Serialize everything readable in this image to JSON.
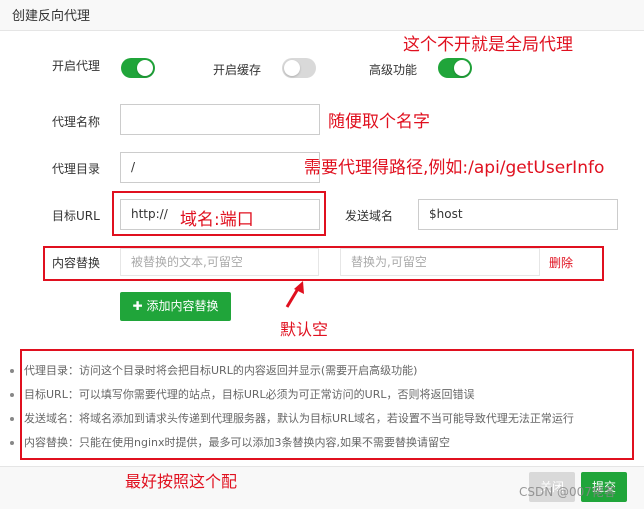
{
  "dialog": {
    "title": "创建反向代理"
  },
  "form": {
    "enable_proxy_label": "开启代理",
    "enable_proxy_on": true,
    "enable_cache_label": "开启缓存",
    "enable_cache_on": false,
    "advanced_label": "高级功能",
    "advanced_on": true,
    "proxy_name_label": "代理名称",
    "proxy_name_value": "",
    "proxy_dir_label": "代理目录",
    "proxy_dir_value": "/",
    "target_url_label": "目标URL",
    "target_url_value": "http://",
    "send_domain_label": "发送域名",
    "send_domain_value": "$host",
    "content_replace_label": "内容替换",
    "replace_from_placeholder": "被替换的文本,可留空",
    "replace_to_placeholder": "替换为,可留空",
    "delete_label": "删除",
    "add_replace_button": "添加内容替换"
  },
  "tips": [
    "代理目录：访问这个目录时将会把目标URL的内容返回并显示(需要开启高级功能)",
    "目标URL：可以填写你需要代理的站点，目标URL必须为可正常访问的URL，否则将返回错误",
    "发送域名：将域名添加到请求头传递到代理服务器，默认为目标URL域名，若设置不当可能导致代理无法正常运行",
    "内容替换：只能在使用nginx时提供，最多可以添加3条替换内容,如果不需要替换请留空"
  ],
  "annotations": {
    "global_proxy": "这个不开就是全局代理",
    "random_name": "随便取个名字",
    "path_example": "需要代理得路径,例如:/api/getUserInfo",
    "domain_port": "域名:端口",
    "default_empty": "默认空",
    "follow_this": "最好按照这个配"
  },
  "footer": {
    "close_label": "关闭",
    "submit_label": "提交"
  },
  "watermark": "CSDN @007佬客",
  "colors": {
    "accent_green": "#20a53a",
    "annotation_red": "#e0101f"
  }
}
